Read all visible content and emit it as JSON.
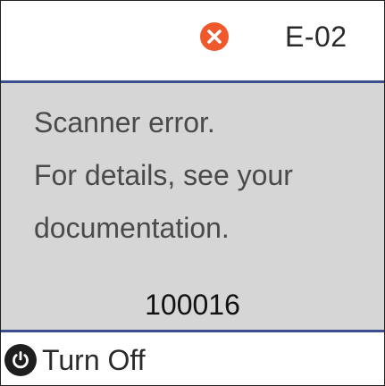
{
  "header": {
    "error_icon": "error-x-icon",
    "error_icon_color": "#f0592b",
    "error_code": "E-02"
  },
  "message": {
    "lines": [
      "Scanner error.",
      "For details, see your",
      "documentation."
    ],
    "code": "100016",
    "background": "#d6d6d6",
    "border_color": "#3b4f8f"
  },
  "footer": {
    "power_icon": "power-icon",
    "turn_off_label": "Turn Off"
  }
}
